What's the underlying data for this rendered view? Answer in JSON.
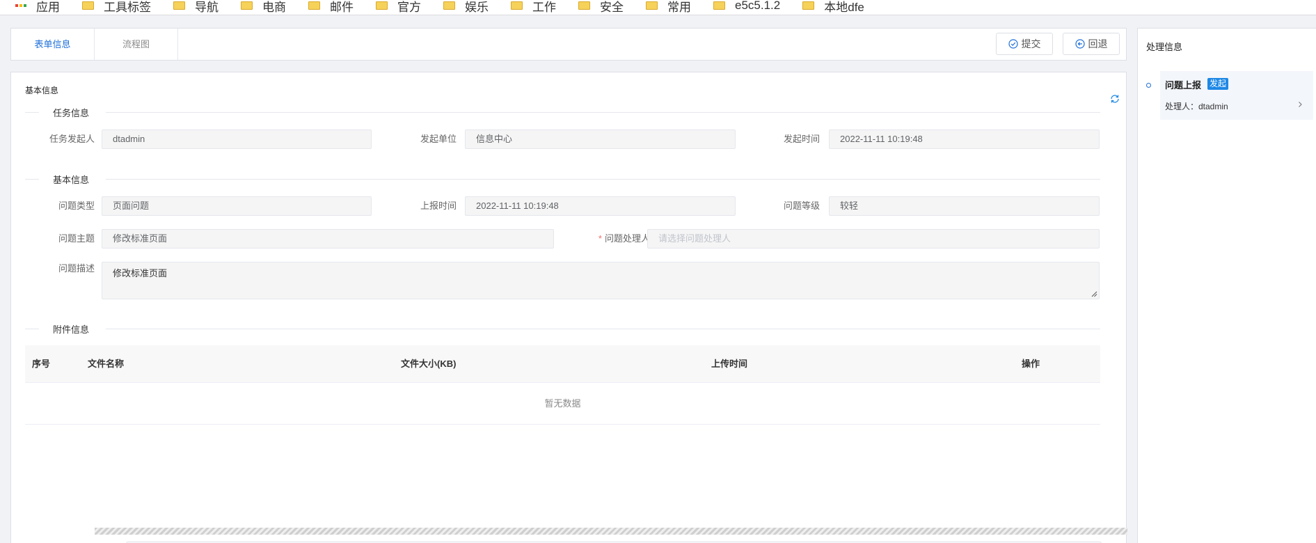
{
  "bookmarks": [
    {
      "label": "应用",
      "icon": "apps-grid-icon"
    },
    {
      "label": "工具标签",
      "icon": "folder-icon"
    },
    {
      "label": "导航",
      "icon": "folder-icon"
    },
    {
      "label": "电商",
      "icon": "folder-icon"
    },
    {
      "label": "邮件",
      "icon": "folder-icon"
    },
    {
      "label": "官方",
      "icon": "folder-icon"
    },
    {
      "label": "娱乐",
      "icon": "folder-icon"
    },
    {
      "label": "工作",
      "icon": "folder-icon"
    },
    {
      "label": "安全",
      "icon": "folder-icon"
    },
    {
      "label": "常用",
      "icon": "folder-icon"
    },
    {
      "label": "e5c5.1.2",
      "icon": "folder-icon"
    },
    {
      "label": "本地dfe",
      "icon": "folder-icon"
    }
  ],
  "tabs": [
    {
      "label": "表单信息",
      "active": true
    },
    {
      "label": "流程图",
      "active": false
    }
  ],
  "toolbar": {
    "submit_label": "提交",
    "submit_icon": "check-circle-icon",
    "back_label": "回退",
    "back_icon": "back-circle-icon"
  },
  "panel": {
    "title": "基本信息",
    "refresh_icon": "refresh-icon"
  },
  "sections": {
    "task": "任务信息",
    "basic": "基本信息",
    "attachment": "附件信息"
  },
  "form": {
    "initiator_label": "任务发起人",
    "initiator_value": "dtadmin",
    "unit_label": "发起单位",
    "unit_value": "信息中心",
    "start_time_label": "发起时间",
    "start_time_value": "2022-11-11 10:19:48",
    "type_label": "问题类型",
    "type_value": "页面问题",
    "report_time_label": "上报时间",
    "report_time_value": "2022-11-11 10:19:48",
    "level_label": "问题等级",
    "level_value": "较轻",
    "subject_label": "问题主题",
    "subject_value": "修改标准页面",
    "handler_required_mark": "*",
    "handler_label": "问题处理人",
    "handler_placeholder": "请选择问题处理人",
    "desc_label": "问题描述",
    "desc_value": "修改标准页面"
  },
  "table": {
    "columns": [
      "序号",
      "文件名称",
      "文件大小(KB)",
      "上传时间",
      "操作"
    ],
    "empty_text": "暂无数据"
  },
  "side": {
    "title": "处理信息",
    "step_name": "问题上报",
    "step_badge": "发起",
    "handler_text": "处理人：dtadmin"
  },
  "colors": {
    "accent": "#1e6fd9",
    "badge": "#1e88e5",
    "required": "#f56c6c"
  }
}
